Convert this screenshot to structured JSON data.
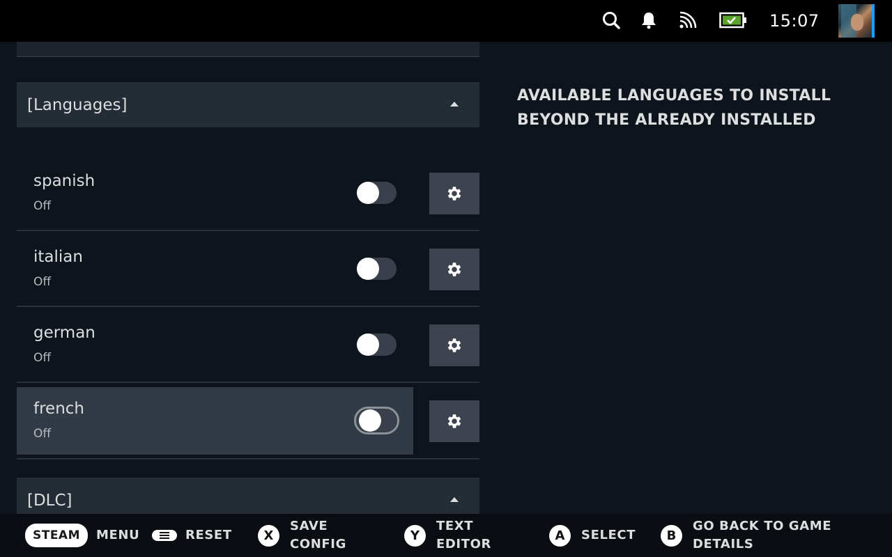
{
  "topbar": {
    "clock": "15:07",
    "icons": [
      "search-icon",
      "notifications-icon",
      "cast-icon",
      "battery-icon"
    ]
  },
  "sections": {
    "languages_label": "[Languages]",
    "dlc_label": "[DLC]"
  },
  "languages": [
    {
      "name": "spanish",
      "state": "Off",
      "enabled": false
    },
    {
      "name": "italian",
      "state": "Off",
      "enabled": false
    },
    {
      "name": "german",
      "state": "Off",
      "enabled": false
    },
    {
      "name": "french",
      "state": "Off",
      "enabled": false,
      "focused": true
    }
  ],
  "description": "AVAILABLE LANGUAGES TO INSTALL BEYOND THE ALREADY INSTALLED",
  "bottom": {
    "steam": "STEAM",
    "menu": "MENU",
    "reset": "RESET",
    "x_key": "X",
    "save_config_1": "SAVE",
    "save_config_2": "CONFIG",
    "y_key": "Y",
    "text_editor_1": "TEXT",
    "text_editor_2": "EDITOR",
    "a_key": "A",
    "select": "SELECT",
    "b_key": "B",
    "go_back_1": "GO BACK TO GAME",
    "go_back_2": "DETAILS"
  },
  "colors": {
    "background": "#0e141b",
    "section": "#242c36",
    "focus_row": "#323a45",
    "gear_button": "#3d4450",
    "battery": "#5ba32b",
    "avatar_border": "#1a9fff"
  }
}
